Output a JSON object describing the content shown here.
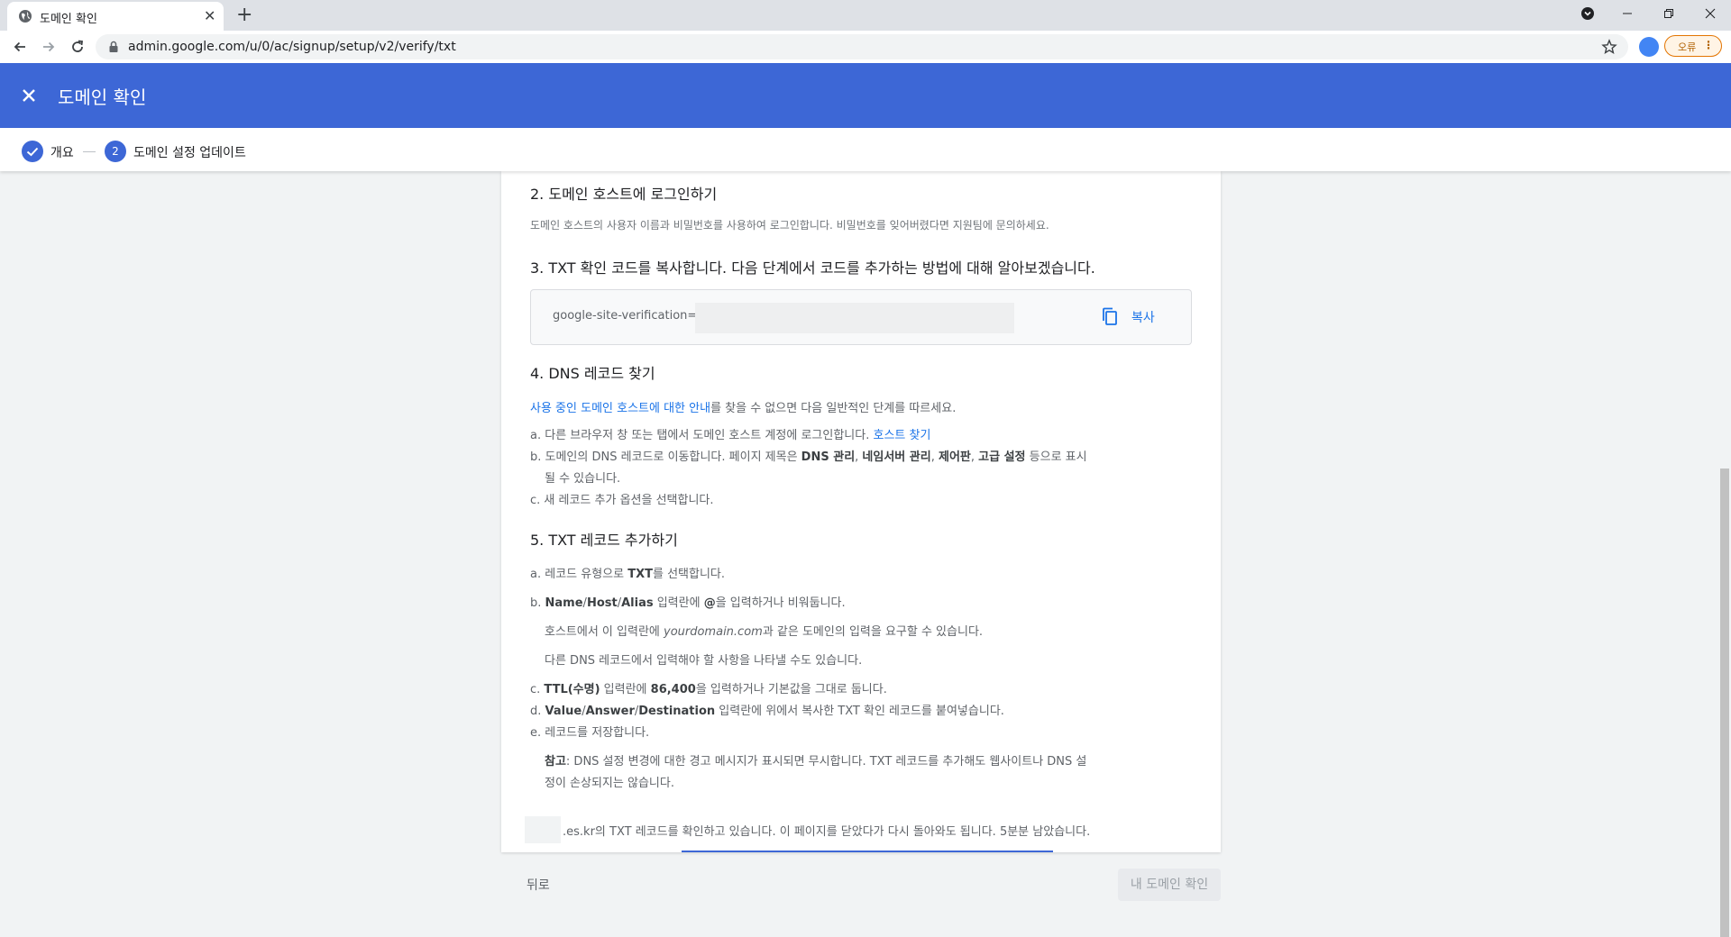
{
  "browser": {
    "tab_title": "도메인 확인",
    "url": "admin.google.com/u/0/ac/signup/setup/v2/verify/txt",
    "error_chip_label": "오류"
  },
  "header": {
    "title": "도메인 확인"
  },
  "stepper": {
    "step1_label": "개요",
    "step2_number": "2",
    "step2_label": "도메인 설정 업데이트"
  },
  "sections": {
    "login": {
      "title": "2. 도메인 호스트에 로그인하기",
      "body": "도메인 호스트의 사용자 이름과 비밀번호를 사용하여 로그인합니다. 비밀번호를 잊어버렸다면 지원팀에 문의하세요."
    },
    "copy": {
      "title": "3. TXT 확인 코드를 복사합니다. 다음 단계에서 코드를 추가하는 방법에 대해 알아보겠습니다.",
      "code": "google-site-verification=k",
      "copy_label": "복사"
    },
    "find": {
      "title": "4. DNS 레코드 찾기",
      "intro_link": "사용 중인 도메인 호스트에 대한 안내",
      "intro_rest": "를 찾을 수 없으면 다음 일반적인 단계를 따르세요.",
      "a_text": "a. 다른 브라우저 창 또는 탭에서 도메인 호스트 계정에 로그인합니다.",
      "a_link": "호스트 찾기",
      "b_pre": "b. 도메인의 DNS 레코드로 이동합니다. 페이지 제목은 ",
      "b_bold1": "DNS 관리",
      "b_sep1": ", ",
      "b_bold2": "네임서버 관리",
      "b_sep2": ", ",
      "b_bold3": "제어판",
      "b_sep3": ", ",
      "b_bold4": "고급 설정",
      "b_post": " 등으로 표시",
      "b_line2": "될 수 있습니다.",
      "c_text": "c. 새 레코드 추가 옵션을 선택합니다."
    },
    "add": {
      "title": "5. TXT 레코드 추가하기",
      "a_pre": "a. 레코드 유형으로 ",
      "a_bold": "TXT",
      "a_post": "를 선택합니다.",
      "b_pre": "b. ",
      "b_bold1": "Name",
      "b_sep1": "/",
      "b_bold2": "Host",
      "b_sep2": "/",
      "b_bold3": "Alias",
      "b_mid": " 입력란에 ",
      "b_bold4": "@",
      "b_post": "을 입력하거나 비워둡니다.",
      "b_note1_pre": "호스트에서 이 입력란에 ",
      "b_note1_italic": "yourdomain.com",
      "b_note1_post": "과 같은 도메인의 입력을 요구할 수 있습니다.",
      "b_note2": "다른 DNS 레코드에서 입력해야 할 사항을 나타낼 수도 있습니다.",
      "c_pre": "c. ",
      "c_bold1": "TTL(수명)",
      "c_mid": " 입력란에 ",
      "c_bold2": "86,400",
      "c_post": "을 입력하거나 기본값을 그대로 둡니다.",
      "d_pre": "d. ",
      "d_bold1": "Value",
      "d_sep1": "/",
      "d_bold2": "Answer",
      "d_sep2": "/",
      "d_bold3": "Destination",
      "d_post": " 입력란에 위에서 복사한 TXT 확인 레코드를 붙여넣습니다.",
      "e_text": "e. 레코드를 저장합니다.",
      "note_bold": "참고",
      "note_text": ": DNS 설정 변경에 대한 경고 메시지가 표시되면 무시합니다. TXT 레코드를 추가해도 웹사이트나 DNS 설",
      "note_line2": "정이 손상되지는 않습니다."
    }
  },
  "status": {
    "text": ".es.kr의 TXT 레코드를 확인하고 있습니다. 이 페이지를 닫았다가 다시 돌아와도 됩니다. 5분분 남았습니다.",
    "progress": 0.72
  },
  "footer": {
    "back_label": "뒤로",
    "verify_label": "내 도메인 확인"
  }
}
